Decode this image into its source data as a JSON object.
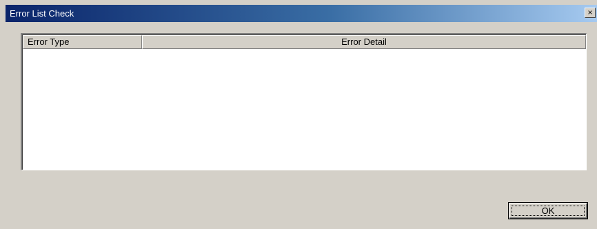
{
  "window": {
    "title": "Error List Check",
    "close_glyph": "×"
  },
  "list": {
    "columns": [
      {
        "label": "Error Type"
      },
      {
        "label": "Error Detail"
      }
    ],
    "rows": []
  },
  "footer": {
    "ok_label": "OK"
  },
  "colors": {
    "titlebar_start": "#0a246a",
    "titlebar_end": "#a6caf0",
    "dialog_bg": "#d4d0c8"
  }
}
